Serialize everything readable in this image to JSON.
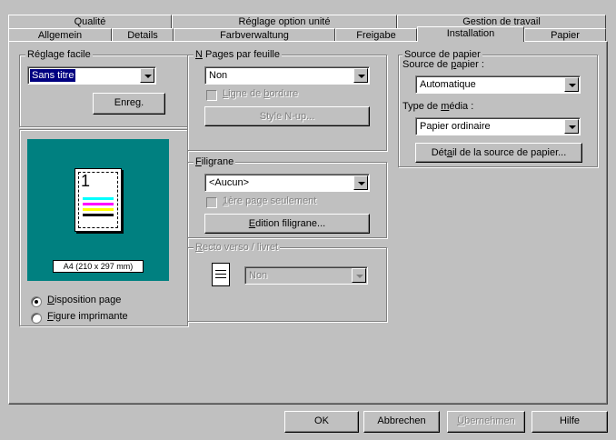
{
  "tabs_back": [
    {
      "label": "Qualité",
      "name": "tab-qualite"
    },
    {
      "label": "Réglage option unité",
      "name": "tab-reglage-option-unite"
    },
    {
      "label": "Gestion de travail",
      "name": "tab-gestion-de-travail"
    }
  ],
  "tabs_front": [
    {
      "label": "Allgemein",
      "name": "tab-allgemein"
    },
    {
      "label": "Details",
      "name": "tab-details"
    },
    {
      "label": "Farbverwaltung",
      "name": "tab-farbverwaltung"
    },
    {
      "label": "Freigabe",
      "name": "tab-freigabe"
    },
    {
      "label": "Installation",
      "name": "tab-installation"
    },
    {
      "label": "Papier",
      "name": "tab-papier"
    }
  ],
  "easy_setting": {
    "legend_pre": "Ré",
    "legend_u": "g",
    "legend_post": "lage facile",
    "value": "Sans titre",
    "save_pre": "Enre",
    "save_u": "g",
    "save_post": "."
  },
  "preview": {
    "page_number": "1",
    "size_label": "A4 (210 x 297 mm)",
    "colors": {
      "bg": "#008080",
      "cyan": "#00ffff",
      "magenta": "#ff00ff",
      "yellow": "#ffff00",
      "black": "#000000"
    },
    "radio_layout_u": "D",
    "radio_layout_post": "isposition page",
    "radio_printer_u": "F",
    "radio_printer_post": "igure imprimante"
  },
  "n_up": {
    "legend_u": "N",
    "legend_post": " Pages par feuille",
    "value": "Non",
    "border_pre": "L",
    "border_mid1": "igne de ",
    "border_u": "b",
    "border_post": "ordure",
    "style_button": "Style N-up..."
  },
  "watermark": {
    "legend_u": "F",
    "legend_post": "iligrane",
    "value": "<Aucun>",
    "first_page_u": "1",
    "first_page_post": "ère page seulement",
    "edit_u": "E",
    "edit_post": "dition filigrane..."
  },
  "duplex": {
    "legend_u": "R",
    "legend_post": "ecto verso / livret",
    "value": "Non"
  },
  "paper_source": {
    "legend": "Source de papier",
    "source_label_pre": "Source de ",
    "source_label_u": "p",
    "source_label_post": "apier :",
    "source_value": "Automatique",
    "media_label_pre": "Type de ",
    "media_label_u": "m",
    "media_label_post": "édia :",
    "media_value": "Papier ordinaire",
    "detail_pre": "Dét",
    "detail_u": "a",
    "detail_post": "il de la source de papier..."
  },
  "footer": {
    "ok": "OK",
    "cancel": "Abbrechen",
    "apply_u": "Ü",
    "apply_post": "bernehmen",
    "help": "Hilfe"
  }
}
